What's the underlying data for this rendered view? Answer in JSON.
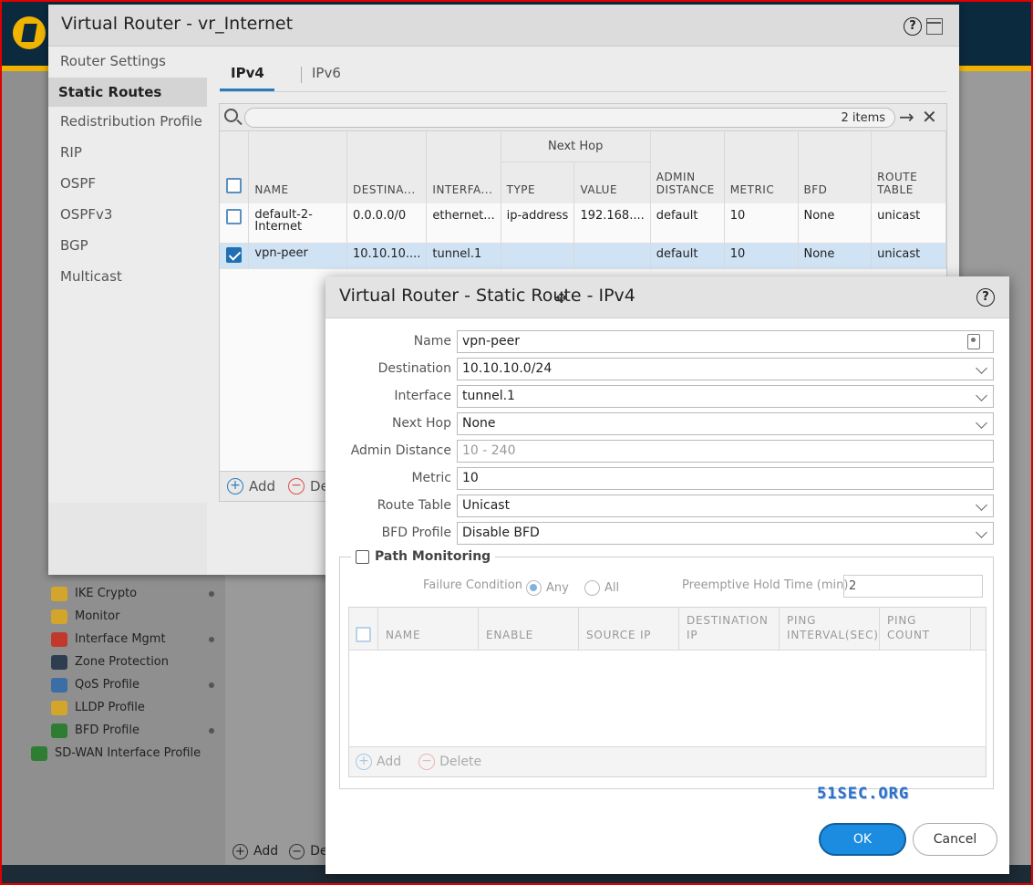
{
  "background": {
    "sidebar_items": [
      {
        "label": "IKE Crypto",
        "icon": "lock-icon",
        "color": "#d4a52b",
        "dot": true
      },
      {
        "label": "Monitor",
        "icon": "monitor-icon",
        "color": "#d4a52b",
        "dot": false
      },
      {
        "label": "Interface Mgmt",
        "icon": "interface-mgmt-icon",
        "color": "#c0392b",
        "dot": true
      },
      {
        "label": "Zone Protection",
        "icon": "shield-icon",
        "color": "#2c3e50",
        "dot": false
      },
      {
        "label": "QoS Profile",
        "icon": "qos-icon",
        "color": "#3a6ea5",
        "dot": true
      },
      {
        "label": "LLDP Profile",
        "icon": "lldp-icon",
        "color": "#d4a52b",
        "dot": false
      },
      {
        "label": "BFD Profile",
        "icon": "bfd-icon",
        "color": "#2e7d32",
        "dot": true
      },
      {
        "label": "SD-WAN Interface Profile",
        "icon": "sdwan-icon",
        "color": "#2e7d32",
        "dot": false
      }
    ],
    "add_label": "Add",
    "delete_partial": "De"
  },
  "vr_dialog": {
    "title": "Virtual Router - vr_Internet",
    "help": "?",
    "nav": [
      "Router Settings",
      "Static Routes",
      "Redistribution Profile",
      "RIP",
      "OSPF",
      "OSPFv3",
      "BGP",
      "Multicast"
    ],
    "active_nav": "Static Routes",
    "tabs": [
      "IPv4",
      "IPv6"
    ],
    "items_count": "2 items",
    "columns": {
      "name": "NAME",
      "destination": "DESTINA...",
      "interface": "INTERFA...",
      "next_hop_group": "Next Hop",
      "type": "TYPE",
      "value": "VALUE",
      "admin_distance": "ADMIN DISTANCE",
      "metric": "METRIC",
      "bfd": "BFD",
      "route_table": "ROUTE TABLE"
    },
    "rows": [
      {
        "name": "default-2-Internet",
        "destination": "0.0.0.0/0",
        "interface": "ethernet...",
        "type": "ip-address",
        "value": "192.168....",
        "admin_distance": "default",
        "metric": "10",
        "bfd": "None",
        "route_table": "unicast",
        "selected": false
      },
      {
        "name": "vpn-peer",
        "destination": "10.10.10....",
        "interface": "tunnel.1",
        "type": "",
        "value": "",
        "admin_distance": "default",
        "metric": "10",
        "bfd": "None",
        "route_table": "unicast",
        "selected": true
      }
    ],
    "add_label": "Add",
    "delete_partial": "Del"
  },
  "sr_dialog": {
    "title": "Virtual Router - Static Route - IPv4",
    "help": "?",
    "fields": {
      "name": {
        "label": "Name",
        "value": "vpn-peer"
      },
      "destination": {
        "label": "Destination",
        "value": "10.10.10.0/24"
      },
      "interface": {
        "label": "Interface",
        "value": "tunnel.1"
      },
      "next_hop": {
        "label": "Next Hop",
        "value": "None"
      },
      "admin_distance": {
        "label": "Admin Distance",
        "placeholder": "10 - 240"
      },
      "metric": {
        "label": "Metric",
        "value": "10"
      },
      "route_table": {
        "label": "Route Table",
        "value": "Unicast"
      },
      "bfd_profile": {
        "label": "BFD Profile",
        "value": "Disable BFD"
      }
    },
    "path_monitoring": {
      "label": "Path Monitoring",
      "checked": false,
      "failure_condition_label": "Failure Condition",
      "options": [
        "Any",
        "All"
      ],
      "selected": "Any",
      "preemptive_label": "Preemptive Hold Time (min)",
      "preemptive_value": "2",
      "columns": [
        "NAME",
        "ENABLE",
        "SOURCE IP",
        "DESTINATION IP",
        "PING INTERVAL(SEC)",
        "PING COUNT"
      ],
      "add_label": "Add",
      "delete_label": "Delete"
    },
    "watermark": "51SEC.ORG",
    "ok_label": "OK",
    "cancel_label": "Cancel"
  },
  "colors": {
    "accent": "#1b8ce0",
    "brand": "#f0b400",
    "frame": "#e00000"
  }
}
